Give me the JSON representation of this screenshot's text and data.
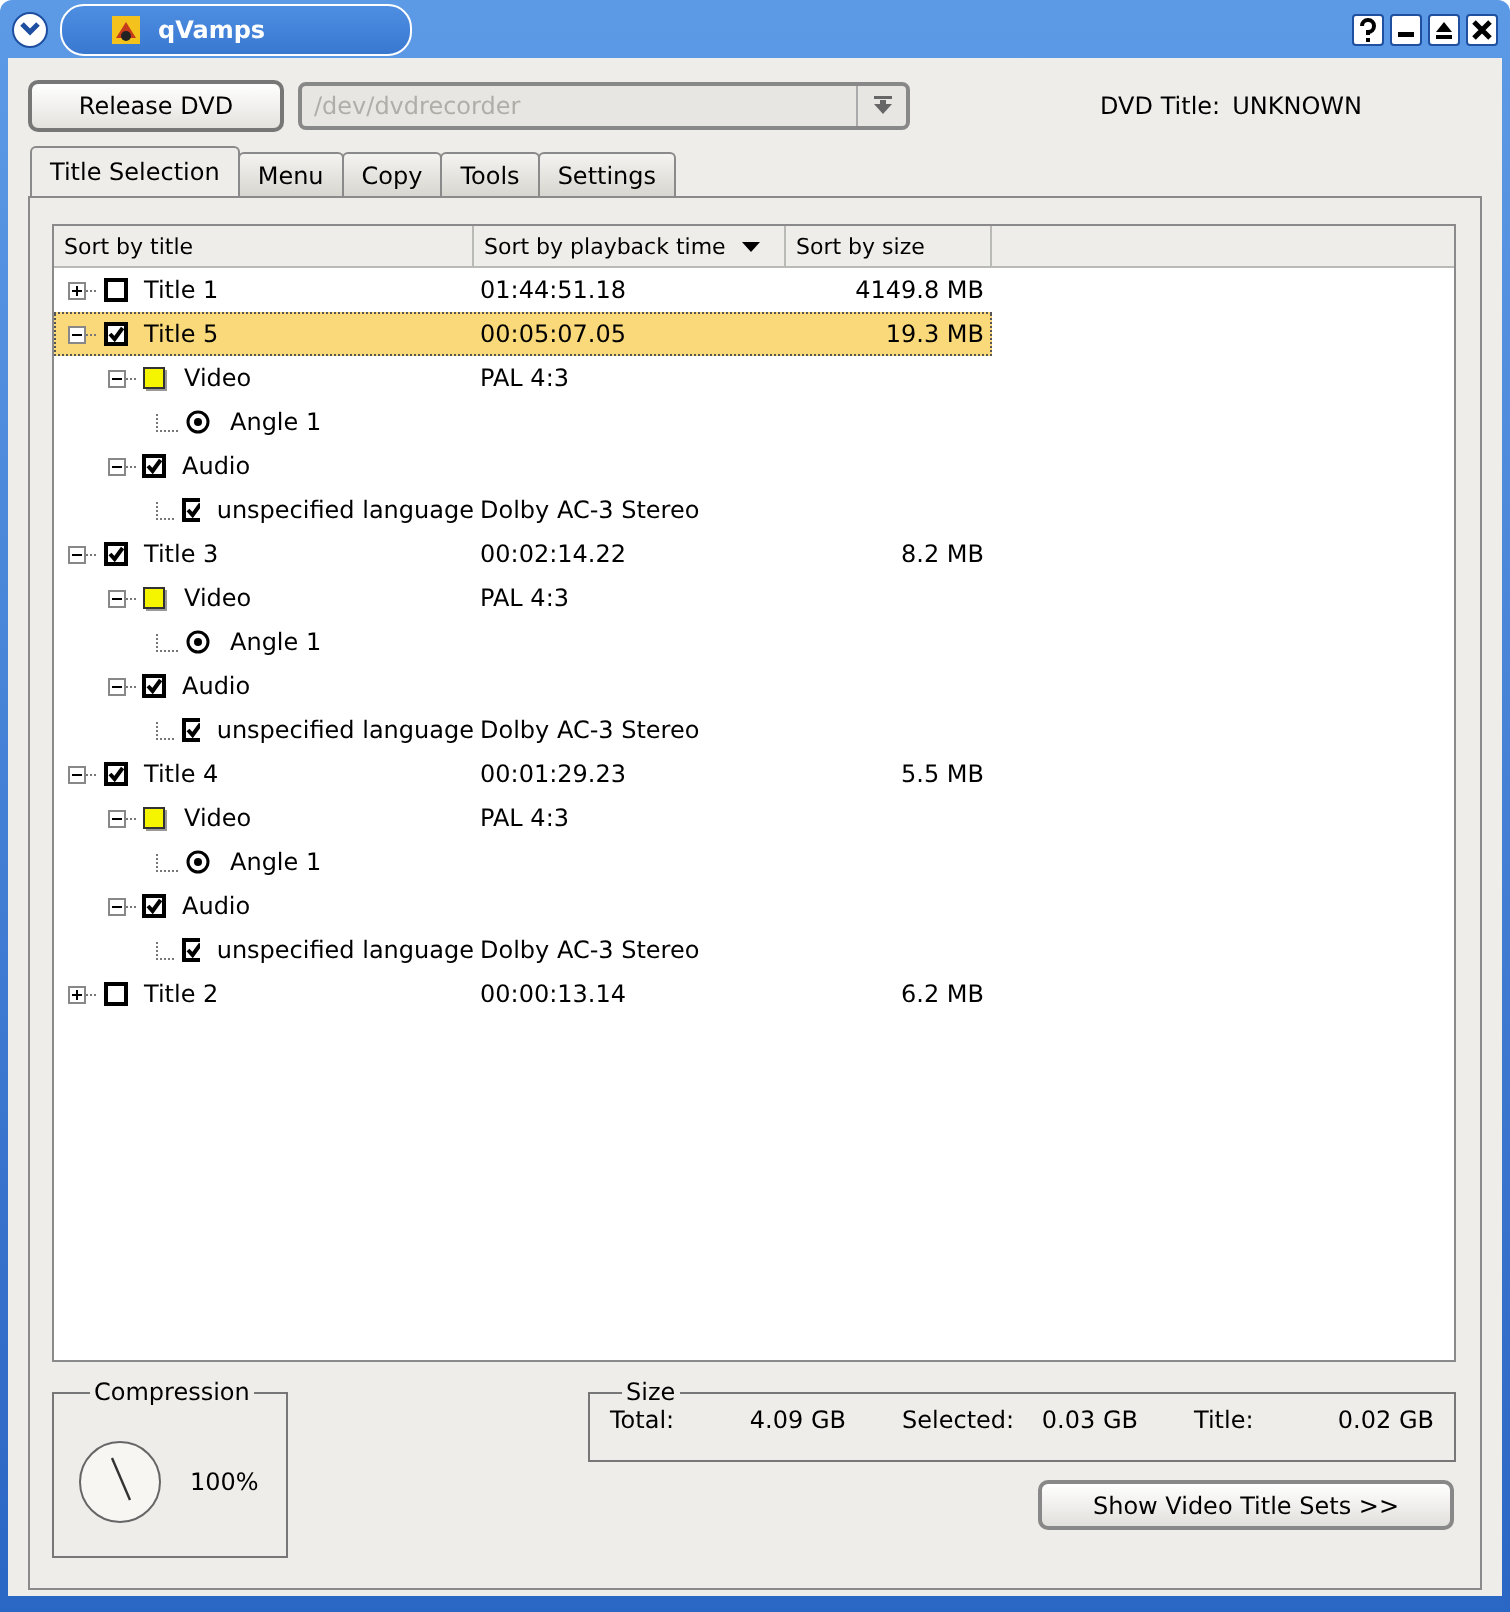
{
  "window": {
    "title": "qVamps"
  },
  "toolbar": {
    "release_button": "Release DVD",
    "device": {
      "value": "/dev/dvdrecorder",
      "disabled": true
    },
    "dvd_title_label": "DVD Title:",
    "dvd_title_value": "UNKNOWN"
  },
  "tabs": [
    {
      "label": "Title Selection",
      "selected": true
    },
    {
      "label": "Menu",
      "selected": false
    },
    {
      "label": "Copy",
      "selected": false
    },
    {
      "label": "Tools",
      "selected": false
    },
    {
      "label": "Settings",
      "selected": false
    }
  ],
  "tree": {
    "columns": [
      {
        "label": "Sort by title",
        "sorted": false
      },
      {
        "label": "Sort by playback time",
        "sorted": true
      },
      {
        "label": "Sort by size",
        "sorted": false
      }
    ],
    "titles": [
      {
        "name": "Title 1",
        "time": "01:44:51.18",
        "size": "4149.8 MB",
        "checked": false,
        "selected": false,
        "expanded": false
      },
      {
        "name": "Title 5",
        "time": "00:05:07.05",
        "size": "19.3 MB",
        "checked": true,
        "selected": true,
        "expanded": true,
        "children": [
          {
            "kind": "video",
            "label": "Video",
            "info": "PAL 4:3",
            "expanded": true,
            "children": [
              {
                "kind": "angle",
                "label": "Angle 1",
                "selected": true
              }
            ]
          },
          {
            "kind": "audio",
            "label": "Audio",
            "checked": true,
            "expanded": true,
            "children": [
              {
                "kind": "track",
                "label": "unspecified language",
                "info": "Dolby AC-3 Stereo",
                "checked": true
              }
            ]
          }
        ]
      },
      {
        "name": "Title 3",
        "time": "00:02:14.22",
        "size": "8.2 MB",
        "checked": true,
        "selected": false,
        "expanded": true,
        "children": [
          {
            "kind": "video",
            "label": "Video",
            "info": "PAL 4:3",
            "expanded": true,
            "children": [
              {
                "kind": "angle",
                "label": "Angle 1",
                "selected": true
              }
            ]
          },
          {
            "kind": "audio",
            "label": "Audio",
            "checked": true,
            "expanded": true,
            "children": [
              {
                "kind": "track",
                "label": "unspecified language",
                "info": "Dolby AC-3 Stereo",
                "checked": true
              }
            ]
          }
        ]
      },
      {
        "name": "Title 4",
        "time": "00:01:29.23",
        "size": "5.5 MB",
        "checked": true,
        "selected": false,
        "expanded": true,
        "children": [
          {
            "kind": "video",
            "label": "Video",
            "info": "PAL 4:3",
            "expanded": true,
            "children": [
              {
                "kind": "angle",
                "label": "Angle 1",
                "selected": true
              }
            ]
          },
          {
            "kind": "audio",
            "label": "Audio",
            "checked": true,
            "expanded": true,
            "children": [
              {
                "kind": "track",
                "label": "unspecified language",
                "info": "Dolby AC-3 Stereo",
                "checked": true
              }
            ]
          }
        ]
      },
      {
        "name": "Title 2",
        "time": "00:00:13.14",
        "size": "6.2 MB",
        "checked": false,
        "selected": false,
        "expanded": false
      }
    ]
  },
  "compression": {
    "title": "Compression",
    "reading": "100%"
  },
  "size": {
    "title": "Size",
    "items": [
      {
        "label": "Total:",
        "value": "4.09 GB"
      },
      {
        "label": "Selected:",
        "value": "0.03 GB"
      },
      {
        "label": "Title:",
        "value": "0.02 GB"
      }
    ]
  },
  "show_vts_button": "Show Video Title Sets >>"
}
